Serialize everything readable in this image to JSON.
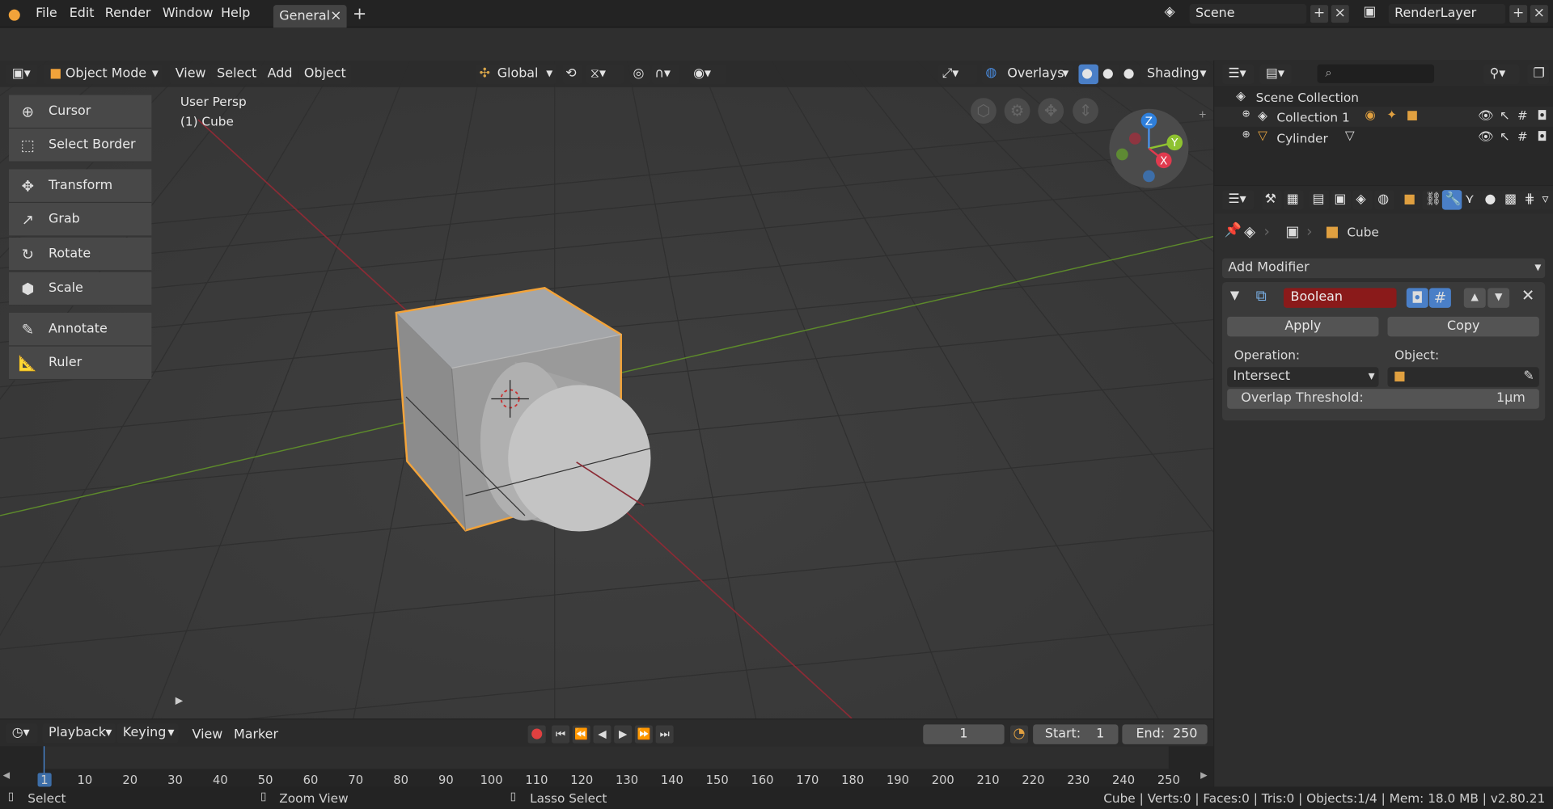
{
  "topbar": {
    "menus": [
      "File",
      "Edit",
      "Render",
      "Window",
      "Help"
    ],
    "workspace_tab": "General",
    "tab_close": "×",
    "tab_add": "+",
    "scene": "Scene",
    "render_layer": "RenderLayer"
  },
  "viewport": {
    "header": {
      "mode": "Object Mode",
      "menus": [
        "View",
        "Select",
        "Add",
        "Object"
      ],
      "transform_orientation": "Global",
      "overlays": "Overlays",
      "shading": "Shading"
    },
    "overlay_text": {
      "view": "User Persp",
      "object": "(1) Cube"
    },
    "tools": [
      "Cursor",
      "Select Border",
      "Transform",
      "Grab",
      "Rotate",
      "Scale",
      "Annotate",
      "Ruler"
    ],
    "gizmo": {
      "z": "Z",
      "y": "Y",
      "x": "X"
    },
    "colors": {
      "x_axis": "#8b2b35",
      "y_axis": "#5d8a2b",
      "selection": "#f2a33a",
      "z_axis": "#2e7fdb"
    }
  },
  "outliner": {
    "root": "Scene Collection",
    "items": [
      "Collection 1",
      "Cylinder"
    ]
  },
  "properties": {
    "object": "Cube",
    "add_modifier": "Add Modifier",
    "modifier": {
      "name": "Boolean",
      "apply": "Apply",
      "copy": "Copy",
      "operation_label": "Operation:",
      "operation": "Intersect",
      "object_label": "Object:",
      "object": "",
      "threshold_label": "Overlap Threshold:",
      "threshold": "1µm"
    }
  },
  "timeline": {
    "menus": [
      "Playback",
      "Keying",
      "View",
      "Marker"
    ],
    "current_frame": "1",
    "start_label": "Start:",
    "start": "1",
    "end_label": "End:",
    "end": "250",
    "ticks": [
      "1",
      "10",
      "20",
      "30",
      "40",
      "50",
      "60",
      "70",
      "80",
      "90",
      "100",
      "110",
      "120",
      "130",
      "140",
      "150",
      "160",
      "170",
      "180",
      "190",
      "200",
      "210",
      "220",
      "230",
      "240",
      "250"
    ]
  },
  "statusbar": {
    "select": "Select",
    "zoom": "Zoom View",
    "lasso": "Lasso Select",
    "stats": "Cube | Verts:0 | Faces:0 | Tris:0 | Objects:1/4 | Mem: 18.0 MB | v2.80.21"
  }
}
